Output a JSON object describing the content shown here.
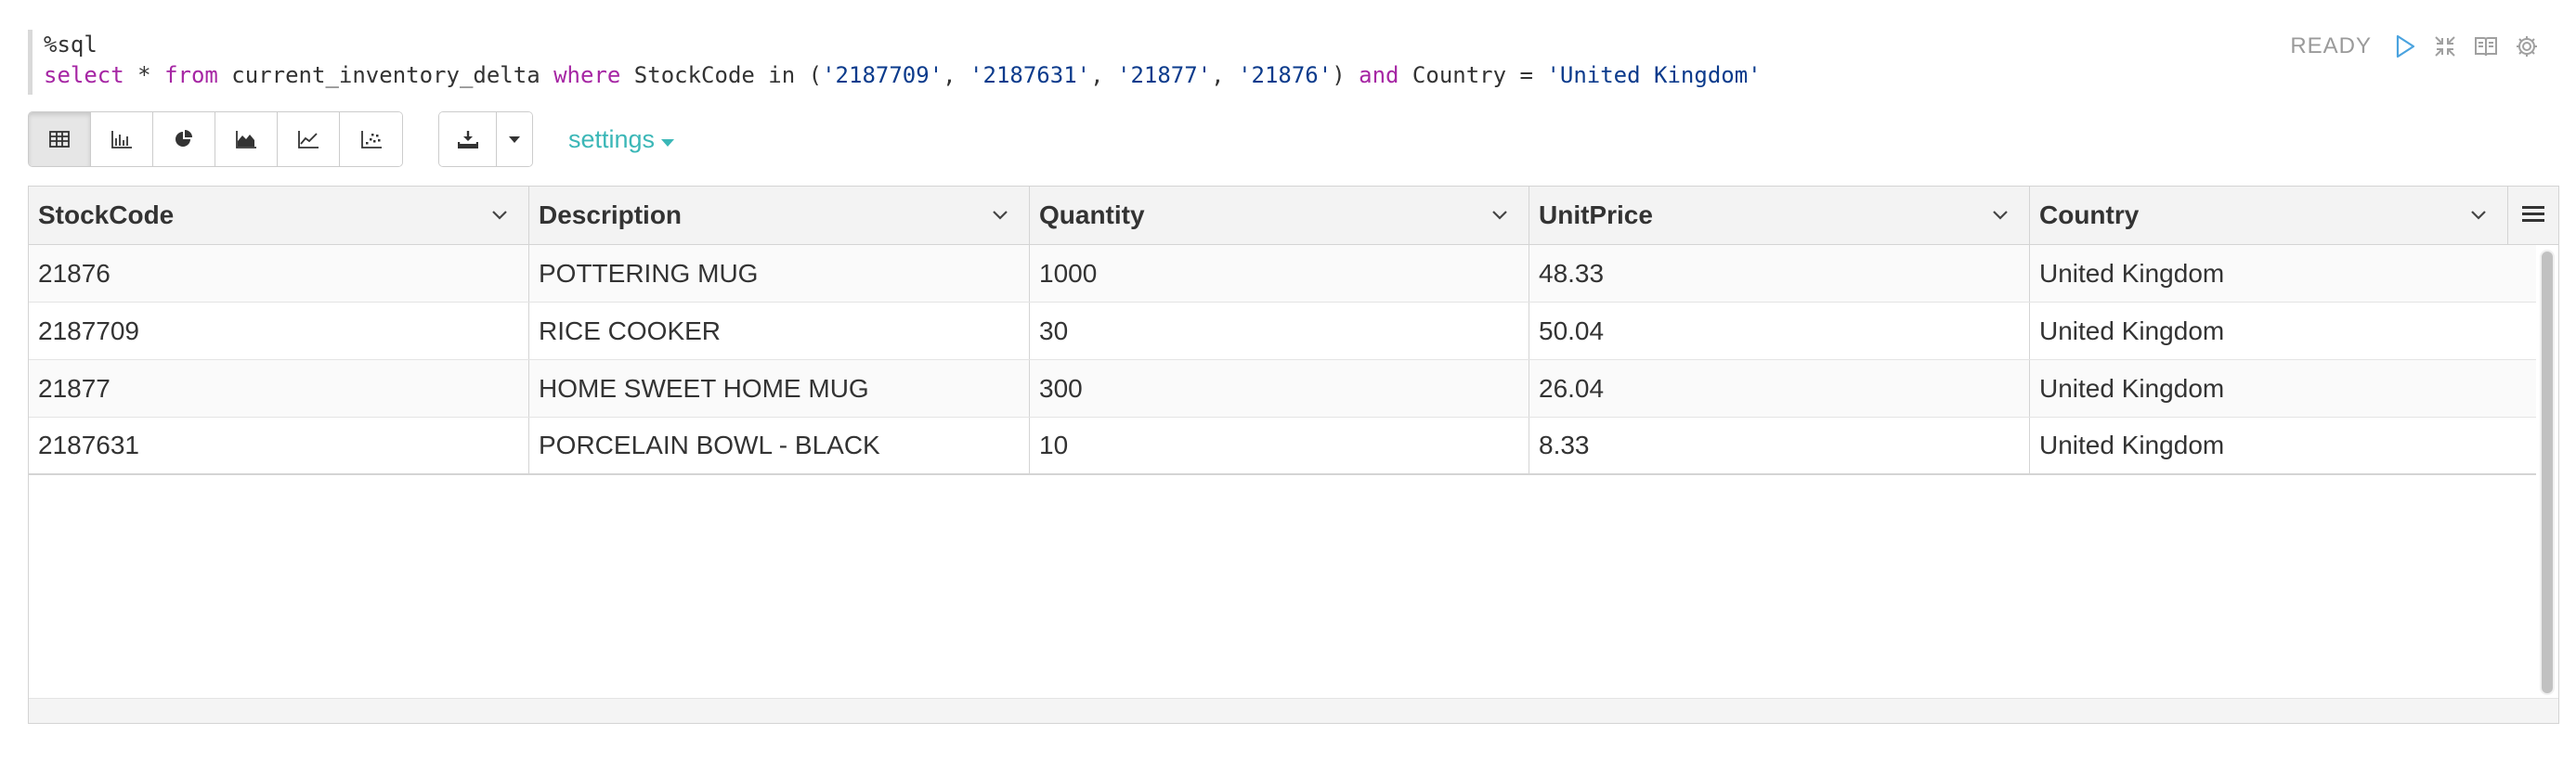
{
  "editor": {
    "magic": "%sql",
    "query": {
      "select_kw": "select",
      "star": " * ",
      "from_kw": "from",
      "table": " current_inventory_delta ",
      "where_kw": "where",
      "field1": " StockCode in (",
      "code1": "'2187709'",
      "sep1": ", ",
      "code2": "'2187631'",
      "sep2": ", ",
      "code3": "'21877'",
      "sep3": ", ",
      "code4": "'21876'",
      "close": ") ",
      "and_kw": "and",
      "field2": " Country = ",
      "country": "'United Kingdom'"
    }
  },
  "status": {
    "state": "READY",
    "icons": [
      "play-icon",
      "collapse-icon",
      "book-icon",
      "gear-icon"
    ]
  },
  "toolbar": {
    "view_buttons": [
      "table-icon",
      "bar-chart-icon",
      "pie-chart-icon",
      "area-chart-icon",
      "line-chart-icon",
      "scatter-chart-icon"
    ],
    "active_view": "table-icon",
    "settings_label": "settings"
  },
  "table": {
    "columns": [
      "StockCode",
      "Description",
      "Quantity",
      "UnitPrice",
      "Country"
    ],
    "rows": [
      [
        "21876",
        "POTTERING MUG",
        "1000",
        "48.33",
        "United Kingdom"
      ],
      [
        "2187709",
        "RICE COOKER",
        "30",
        "50.04",
        "United Kingdom"
      ],
      [
        "21877",
        "HOME SWEET HOME MUG",
        "300",
        "26.04",
        "United Kingdom"
      ],
      [
        "2187631",
        "PORCELAIN BOWL - BLACK",
        "10",
        "8.33",
        "United Kingdom"
      ]
    ]
  },
  "colors": {
    "keyword": "#a626a4",
    "string": "#0b3b8c",
    "settings": "#3bb7b7",
    "header_bg": "#f3f3f3"
  }
}
